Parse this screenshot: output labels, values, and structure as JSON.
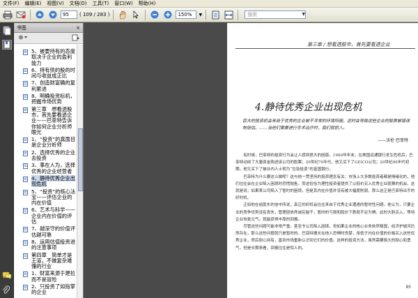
{
  "menu": [
    "文件(F)",
    "编辑(E)",
    "视图(V)",
    "文档(D)",
    "工具(T)",
    "窗口(W)",
    "帮助(H)"
  ],
  "toolbar": {
    "page_current": "95",
    "page_count": "( 109 / 283 )",
    "zoom": "150%",
    "search_placeholder": "搜索"
  },
  "bookmarks": {
    "title": "书签",
    "close": "×",
    "items": [
      {
        "label": "5、被要持有的态度取决于企业的盈利能力",
        "selected": false
      },
      {
        "label": "6、持有债的股的时间与收益成正比",
        "selected": false
      },
      {
        "label": "7、创造财富确的复利累进",
        "selected": false
      },
      {
        "label": "8、明确投资标机，把握市场优势",
        "selected": false
      },
      {
        "label": "第三章　想看透股市，首先要看透企业——巴菲特告诉你如何企业分析师眼光",
        "selected": false
      },
      {
        "label": "1、“投资”的真面目是企业分析师",
        "selected": false
      },
      {
        "label": "2、选择优秀的企业去投资",
        "selected": false
      },
      {
        "label": "3、事在人为，选择优秀的企业经营者",
        "selected": false
      },
      {
        "label": "4、静待优秀企业出现危机",
        "selected": true
      },
      {
        "label": "5、“投资”的核心法宝——评估企业的内在价值",
        "selected": false
      },
      {
        "label": "6、艺术与科学——企业内在价值的评估",
        "selected": false
      },
      {
        "label": "7、越深守的价值评估越可靠",
        "selected": false
      },
      {
        "label": "8、运用估值投资进的注意事项",
        "selected": false
      },
      {
        "label": "第四章　简单才是王道，不做复杂难懂的行业",
        "selected": false
      },
      {
        "label": "1、财富来源于建拉而不是冒险",
        "selected": false
      },
      {
        "label": "2、只投资了如指掌的企业",
        "selected": false
      }
    ]
  },
  "page": {
    "running_head": "第三章 / 想看透股市，首先要看透企业",
    "section_title": "4.静待优秀企业出现危机",
    "quote": "巨大的投资机会来自于优秀的企业被不寻常的环境所困，这时会导致这些企业的股票被错误地低估。……当他们需要进行手术治疗时，我们就抓入。",
    "quote_attribution": "——沃伦·巴菲特",
    "paragraphs": [
      "有时候，巴菲特的投资行为会让人感到很大的困惑。1960年年末，在美国运通银行发生危机后，巴菲特动用了大量资金购进该公司的股票；20世纪70年代，他又买下了GEICO公司；20世纪90年代初期，他又买下了被业内人士视为“垃圾投资”的富国银行。",
      "巴菲特为什么要这么做呢？这与他一贯坚持的投资理念有关：市场上大多数投资者都是情绪化的，他们往往会在企业陷入困境时恐慌抛售，而这恰恰为理性投资者提供了以低价买入优秀企业股票的机会。这就是说，如果某公司陷入了暂时的困境，但是其内在价值并没有被大幅度削弱，那么这正是巴菲特出手的好时机。",
      "正如他在给股东的信中所说，真正的好机会往往来自于优秀企业遭遇的暂时性问题。他认为，只要企业的竞争优势没有丧失，管理层依然诚实能干，暂时的亏损和股价下跌就不足为惧。此时大胆买入，等待企业恢复元气，就能获得丰厚的回报。",
      "尽管这些问题可能非常严重，甚至令公司陷入困境，但如果企业的核心业务依然稳固，经济护城河仍然存在，那么这些问题就只是暂时的。巴菲特擅长在他人恐惧时贪婪，用低于内在价值的价格买入这些优秀企业，然后耐心持有，直到市场重新认识到它们的价值。这样的投资方法，虽然需要极大的耐心和勇气，但是长期来看，回报往往是惊人的。"
    ],
    "page_number": "95"
  }
}
